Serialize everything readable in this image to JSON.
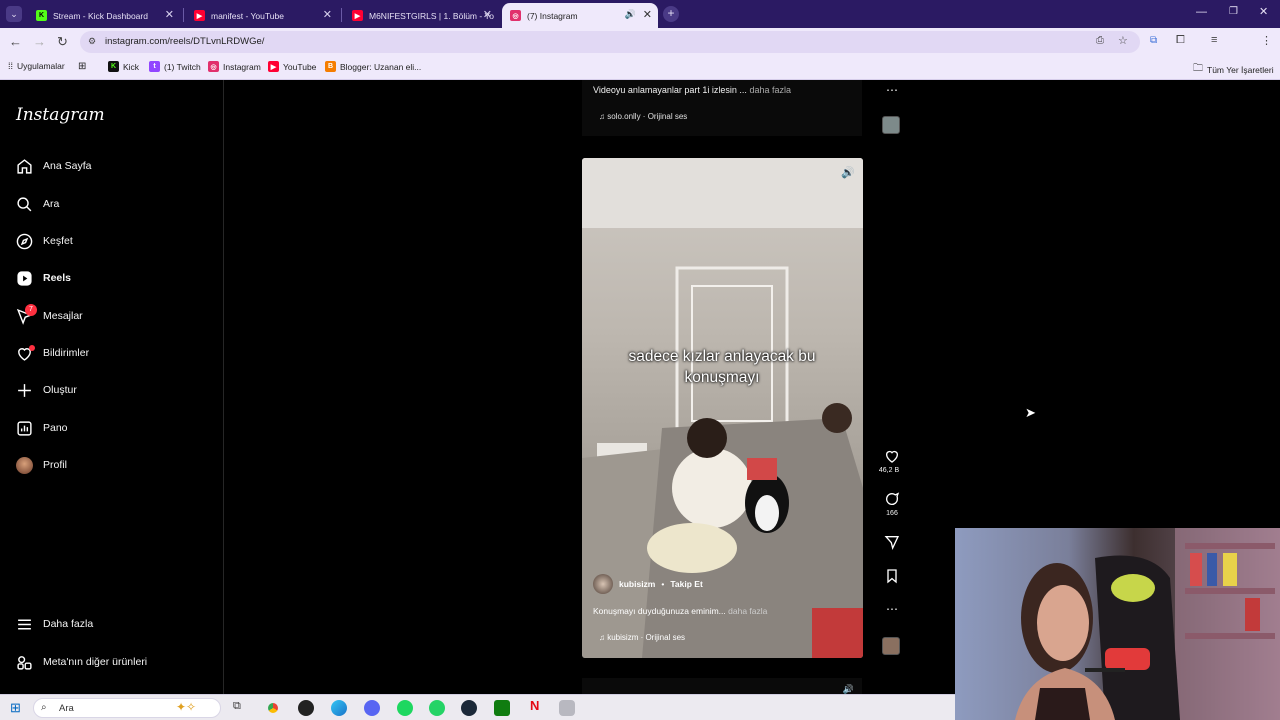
{
  "browser": {
    "tabs": [
      {
        "title": "Stream - Kick Dashboard",
        "icon": "kick-icon",
        "color": "#53fc18"
      },
      {
        "title": "manifest - YouTube",
        "icon": "youtube-icon",
        "color": "#ff0033"
      },
      {
        "title": "M6NIFESTGIRLS | 1. Bölüm - Yo",
        "icon": "youtube-icon",
        "color": "#ff0033"
      },
      {
        "title": "(7) Instagram",
        "icon": "instagram-icon",
        "color": "#e1306c"
      }
    ],
    "url": "instagram.com/reels/DTLvnLRDWGe/",
    "bookmarks": [
      {
        "label": "Uygulamalar",
        "icon": "apps-grid-icon"
      },
      {
        "label": "",
        "icon": "grid-icon"
      },
      {
        "label": "Kick",
        "icon": "kick-icon"
      },
      {
        "label": "(1) Twitch",
        "icon": "twitch-icon"
      },
      {
        "label": "Instagram",
        "icon": "instagram-icon"
      },
      {
        "label": "YouTube",
        "icon": "youtube-icon"
      },
      {
        "label": "Blogger: Uzanan eli...",
        "icon": "blogger-icon"
      }
    ],
    "all_bookmarks": "Tüm Yer İşaretleri"
  },
  "instagram": {
    "logo": "Instagram",
    "nav": [
      {
        "label": "Ana Sayfa",
        "icon": "home-icon"
      },
      {
        "label": "Ara",
        "icon": "search-icon"
      },
      {
        "label": "Keşfet",
        "icon": "compass-icon"
      },
      {
        "label": "Reels",
        "icon": "reels-icon",
        "active": true
      },
      {
        "label": "Mesajlar",
        "icon": "messenger-icon",
        "badge": "7"
      },
      {
        "label": "Bildirimler",
        "icon": "heart-icon",
        "dot": true
      },
      {
        "label": "Oluştur",
        "icon": "plus-icon"
      },
      {
        "label": "Pano",
        "icon": "dashboard-icon"
      },
      {
        "label": "Profil",
        "icon": "avatar"
      }
    ],
    "more": "Daha fazla",
    "meta": "Meta'nın diğer ürünleri",
    "prev_reel": {
      "caption": "Videoyu anlamayanlar part 1i izlesin ...",
      "more": "daha fazla",
      "audio": "solo.onlly · Orijinal ses"
    },
    "reel": {
      "overlay_text": "sadece kızlar anlayacak bu konuşmayı",
      "username": "kubisizm",
      "follow": "Takip Et",
      "caption": "Konuşmayı duyduğunuza eminim...",
      "more": "daha fazla",
      "audio": "kubisizm · Orijinal ses",
      "likes": "46,2 B",
      "comments": "166"
    }
  },
  "taskbar": {
    "search_placeholder": "Ara"
  }
}
